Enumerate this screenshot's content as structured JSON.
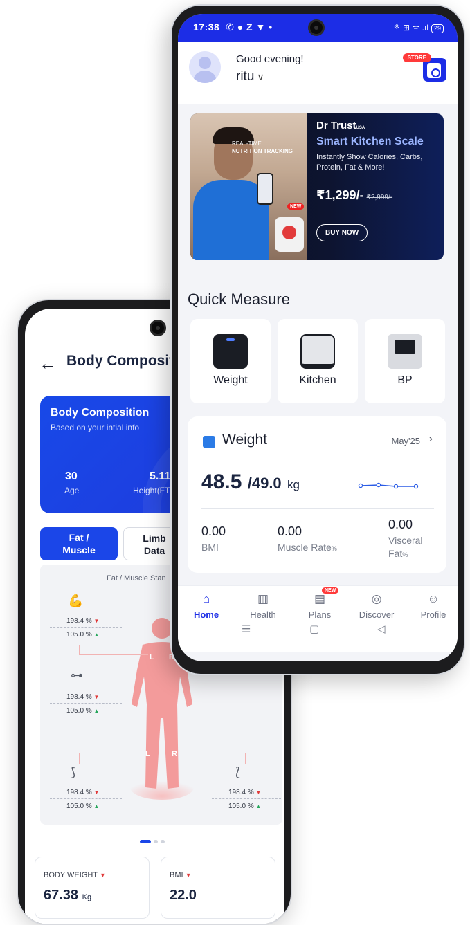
{
  "back_phone": {
    "header": {
      "back_icon": "arrow-left-icon",
      "title": "Body Compositi"
    },
    "card": {
      "title": "Body Composition",
      "subtitle": "Based on your intial info",
      "stats": [
        {
          "value": "30",
          "label": "Age"
        },
        {
          "value": "5.11",
          "label": "Height(FT,"
        }
      ]
    },
    "tabs": [
      {
        "line1": "Fat /",
        "line2": "Muscle"
      },
      {
        "line1": "Limb",
        "line2": "Data"
      }
    ],
    "panel": {
      "title": "Fat / Muscle Stan",
      "left_label": "L",
      "right_label": "R",
      "groups": [
        {
          "icon": "arm-muscle-icon",
          "a": "198.4",
          "b": "105.0",
          "unit": "%"
        },
        {
          "icon": "dumbbell-icon",
          "a": "198.4",
          "b": "105.0",
          "unit": "%"
        },
        {
          "icon": "leg-left-icon",
          "a": "198.4",
          "b": "105.0",
          "unit": "%"
        },
        {
          "icon": "leg-right-icon",
          "a": "198.4",
          "b": "105.0",
          "unit": "%"
        }
      ]
    },
    "mini_cards": [
      {
        "label": "BODY WEIGHT",
        "value": "67.38",
        "unit": "Kg"
      },
      {
        "label": "BMI",
        "value": "22.0",
        "unit": ""
      }
    ]
  },
  "front_phone": {
    "status_bar": {
      "time": "17:38",
      "left_icons": "✆ ● Z ▼ •",
      "right_icons": "⚘ ⊞ ᯤ .ıl",
      "battery": "29"
    },
    "header": {
      "greeting": "Good evening!",
      "username": "ritu",
      "store_badge": "STORE"
    },
    "banner": {
      "left_text_1": "REAL-TIME",
      "left_text_2": "NUTRITION TRACKING",
      "new_tag": "NEW",
      "brand": "Dr Trust",
      "brand_suffix": "USA",
      "product": "Smart Kitchen Scale",
      "description": "Instantly Show Calories, Carbs, Protein, Fat & More!",
      "price": "₹1,299/-",
      "old_price": "₹2,999/-",
      "cta": "BUY NOW"
    },
    "quick_measure": {
      "title": "Quick Measure",
      "items": [
        {
          "label": "Weight",
          "icon": "scale-icon"
        },
        {
          "label": "Kitchen",
          "icon": "kitchen-scale-icon"
        },
        {
          "label": "BP",
          "icon": "bp-monitor-icon"
        }
      ]
    },
    "weight_card": {
      "title": "Weight",
      "month": "May'25",
      "current": "48.5",
      "goal": "/49.0",
      "unit": "kg",
      "metrics": [
        {
          "value": "0.00",
          "label": "BMI",
          "label2": ""
        },
        {
          "value": "0.00",
          "label": "Muscle Rate",
          "label2": ""
        },
        {
          "value": "0.00",
          "label": "Visceral",
          "label2": "Fat"
        }
      ],
      "unit_suffix": "%"
    },
    "tabbar": {
      "items": [
        {
          "label": "Home",
          "icon": "home-icon"
        },
        {
          "label": "Health",
          "icon": "bar-chart-icon"
        },
        {
          "label": "Plans",
          "icon": "plans-icon",
          "badge": "NEW"
        },
        {
          "label": "Discover",
          "icon": "compass-icon"
        },
        {
          "label": "Profile",
          "icon": "profile-icon"
        }
      ]
    }
  },
  "colors": {
    "brand_blue": "#1c2de6",
    "accent_red": "#ff3a3a",
    "body_figure": "#f39b9b"
  }
}
